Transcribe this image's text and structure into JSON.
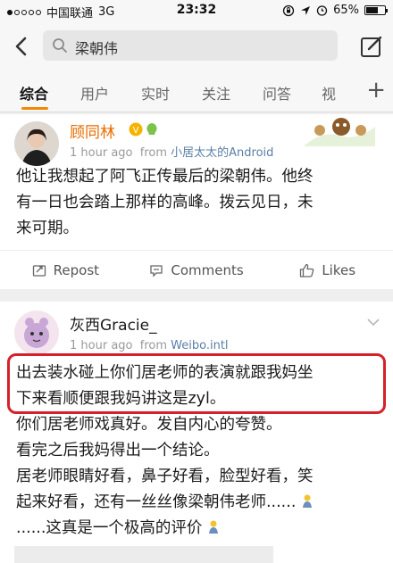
{
  "status_bar": {
    "carrier": "中国联通",
    "network": "3G",
    "time": "23:32",
    "battery": "65%",
    "battery_level": 0.65
  },
  "header": {
    "search_query": "梁朝伟"
  },
  "tabs": [
    "综合",
    "用户",
    "实时",
    "关注",
    "问答",
    "视"
  ],
  "posts": [
    {
      "username": "顾同林",
      "time": "1 hour ago",
      "from_prefix": "from",
      "source": "小居太太的Android",
      "lines": [
        "他让我想起了阿飞正传最后的梁朝伟。他终",
        "有一日也会踏上那样的高峰。拨云见日，未",
        "来可期。"
      ],
      "actions": {
        "repost": "Repost",
        "comments": "Comments",
        "likes": "Likes"
      }
    },
    {
      "username": "灰西Gracie_",
      "time": "1 hour ago",
      "from_prefix": "from",
      "source": "Weibo.intl",
      "lines": [
        "出去装水碰上你们居老师的表演就跟我妈坐",
        "下来看顺便跟我妈讲这是zyl。",
        "你们居老师戏真好。发自内心的夸赞。",
        "看完之后我妈得出一个结论。",
        "居老师眼睛好看，鼻子好看，脸型好看，笑",
        "起来好看，还有一丝丝像梁朝伟老师......",
        "......这真是一个极高的评价"
      ]
    }
  ],
  "colors": {
    "accent": "#f08a00",
    "highlight_box": "#d4212b",
    "source_link": "#5a7fa7"
  }
}
